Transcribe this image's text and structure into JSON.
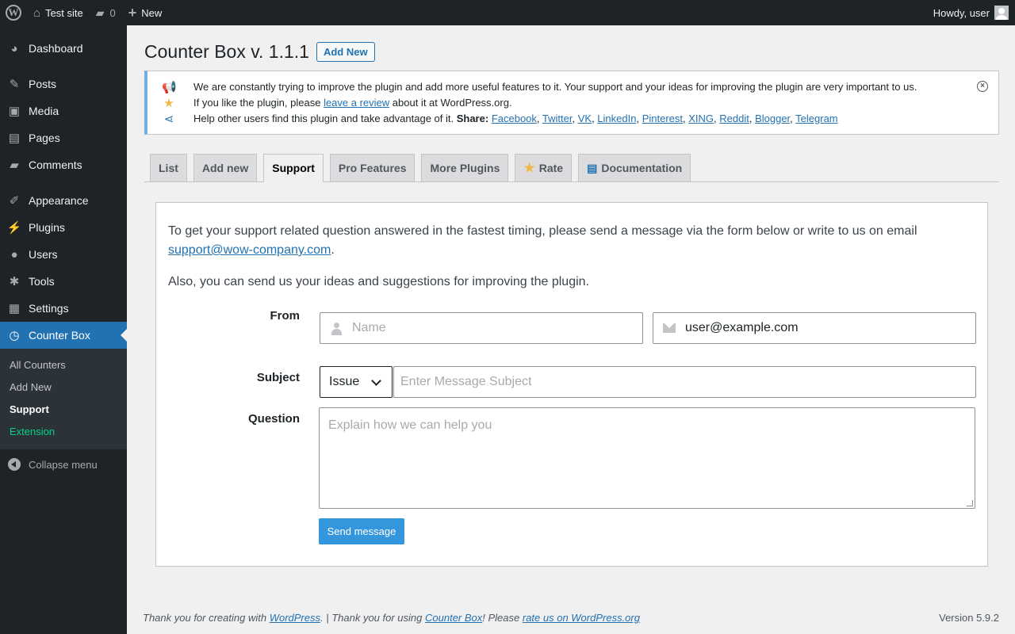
{
  "adminbar": {
    "site_name": "Test site",
    "comments_count": "0",
    "new_label": "New",
    "howdy": "Howdy, user"
  },
  "sidebar": {
    "items": [
      {
        "label": "Dashboard",
        "icon": "dashboard-icon"
      },
      {
        "label": "Posts",
        "icon": "pin-icon"
      },
      {
        "label": "Media",
        "icon": "media-icon"
      },
      {
        "label": "Pages",
        "icon": "pages-icon"
      },
      {
        "label": "Comments",
        "icon": "comment-icon"
      },
      {
        "label": "Appearance",
        "icon": "brush-icon"
      },
      {
        "label": "Plugins",
        "icon": "plug-icon"
      },
      {
        "label": "Users",
        "icon": "user-icon"
      },
      {
        "label": "Tools",
        "icon": "wrench-icon"
      },
      {
        "label": "Settings",
        "icon": "settings-icon"
      },
      {
        "label": "Counter Box",
        "icon": "clock-icon"
      }
    ],
    "submenu": [
      "All Counters",
      "Add New",
      "Support",
      "Extension"
    ],
    "collapse": "Collapse menu"
  },
  "page": {
    "title": "Counter Box v. 1.1.1",
    "add_new": "Add New"
  },
  "notice": {
    "line1": "We are constantly trying to improve the plugin and add more useful features to it. Your support and your ideas for improving the plugin are very important to us.",
    "line2_pre": "If you like the plugin, please ",
    "line2_link": "leave a review",
    "line2_post": " about it at WordPress.org.",
    "line3_pre": "Help other users find this plugin and take advantage of it. ",
    "line3_bold": "Share:",
    "share_links": [
      "Facebook",
      "Twitter",
      "VK",
      "LinkedIn",
      "Pinterest",
      "XING",
      "Reddit",
      "Blogger",
      "Telegram"
    ]
  },
  "tabs": [
    "List",
    "Add new",
    "Support",
    "Pro Features",
    "More Plugins",
    "Rate",
    "Documentation"
  ],
  "support": {
    "intro": "To get your support related question answered in the fastest timing, please send a message via the form below or write to us on email ",
    "email": "support@wow-company.com",
    "intro_end": ".",
    "ideas": "Also, you can send us your ideas and suggestions for improving the plugin.",
    "from_label": "From",
    "name_placeholder": "Name",
    "email_value": "user@example.com",
    "subject_label": "Subject",
    "subject_select": "Issue",
    "subject_placeholder": "Enter Message Subject",
    "question_label": "Question",
    "question_placeholder": "Explain how we can help you",
    "send": "Send message"
  },
  "footer": {
    "t1": "Thank you for creating with ",
    "wp": "WordPress",
    "t2": ". | Thank you for using ",
    "cb": "Counter Box",
    "t3": "! Please ",
    "rate": "rate us on WordPress.org",
    "version": "Version 5.9.2"
  },
  "colors": {
    "accent": "#2271b1",
    "admin_dark": "#1d2327",
    "send_button": "#3497dd",
    "extension_green": "#00d084"
  }
}
